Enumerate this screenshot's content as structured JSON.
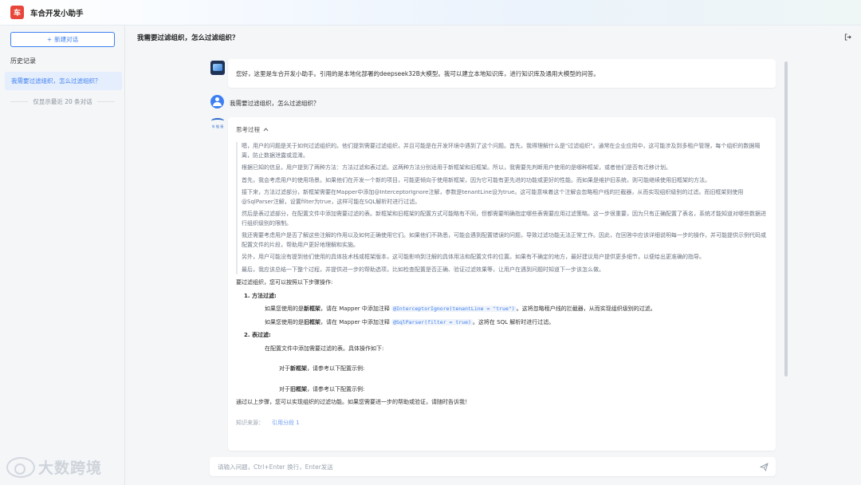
{
  "app": {
    "logo_char": "车",
    "title": "车合开发小助手"
  },
  "sidebar": {
    "new_chat_label": "新建对话",
    "history_title": "历史记录",
    "history_items": [
      "我需要过滤组织，怎么过滤组织？"
    ],
    "history_note": "仅显示最近 20 条对话"
  },
  "chat": {
    "title": "我需要过滤组织，怎么过滤组织？",
    "welcome": "您好，这里是车合开发小助手。引用的是本地化部署的deepseek32B大模型。我可以建立本地知识库，进行知识库及通用大模型的问答。",
    "user_message": "我需要过滤组织，怎么过滤组织？",
    "bot_logo_text": "车 链 接",
    "thinking_label": "思考过程",
    "thinking_paragraphs": [
      "嗯，用户的问题是关于如何过滤组织的。他们提到需要过滤组织，并且可能是在开发环境中遇到了这个问题。首先，我得理解什么是\"过滤组织\"。通常在企业应用中，这可能涉及到多租户管理，每个组织的数据隔离，防止数据泄露或混淆。",
      "根据已知的信息，用户提到了两种方法：方法过滤和表过滤。这两种方法分别适用于新框架和旧框架。所以，我需要先判断用户使用的是哪种框架，或者他们是否有迁移计划。",
      "首先，我会考虑用户的使用场景。如果他们在开发一个新的项目，可能更倾向于使用新框架，因为它可能有更先进的功能或更好的性能。而如果是维护旧系统，则可能继续使用旧框架的方法。",
      "接下来，方法过滤部分，新框架需要在Mapper中添加@InterceptorIgnore注解，参数是tenantLine设为true。这可能意味着这个注解会忽略租户线的拦截器，从而实现组织级别的过滤。而旧框架则使用@SqlParser注解，设置filter为true，这样可能在SQL解析时进行过滤。",
      "然后是表过滤部分，在配置文件中添加需要过滤的表。新框架和旧框架的配置方式可能略有不同，但都需要明确指定哪些表需要应用过滤策略。这一步很重要，因为只有正确配置了表名，系统才能知道对哪些数据进行组织级别的限制。",
      "我还需要考虑用户是否了解这些注解的作用以及如何正确使用它们。如果他们不熟悉，可能会遇到配置错误的问题，导致过滤功能无法正常工作。因此，在回答中应该详细说明每一步的操作，并可能提供示例代码或配置文件的片段，帮助用户更好地理解和实施。",
      "另外，用户可能没有提到他们使用的具体技术栈或框架版本，这可能影响到注解的具体用法和配置文件的位置。如果有不确定的地方，最好建议用户提供更多细节，以便给出更准确的指导。",
      "最后，我应该总结一下整个过程，并提供进一步的帮助选项，比如检查配置是否正确、验证过滤效果等，让用户在遇到问题时知道下一步该怎么做。"
    ],
    "answer_intro": "要过滤组织，您可以按照以下步骤操作:",
    "step1_title": "1. 方法过滤:",
    "step1_line1": {
      "pre": "如果您使用的是",
      "bold": "新框架",
      "mid": "，请在 Mapper 中添加注释 ",
      "code": "@InterceptorIgnore(tenantLine = \"true\")",
      "post": "。这将忽略租户线的拦截器，从而实现组织级别的过滤。"
    },
    "step1_line2": {
      "pre": "如果您使用的是",
      "bold": "旧框架",
      "mid": "，请在 Mapper 中添加注释 ",
      "code": "@SqlParser(filter = true)",
      "post": "。这将在 SQL 解析时进行过滤。"
    },
    "step2_title": "2. 表过滤:",
    "step2_line": "在配置文件中添加需要过滤的表。具体操作如下:",
    "step2_new": {
      "pre": "对于",
      "bold": "新框架",
      "post": "，请参考以下配置示例:"
    },
    "step2_old": {
      "pre": "对于",
      "bold": "旧框架",
      "post": "，请参考以下配置示例:"
    },
    "answer_outro": "通过以上步骤，您可以实现组织的过滤功能。如果您需要进一步的帮助或验证，请随时告诉我！",
    "sources_label": "知识来源：",
    "sources_ref": "引用分段 1"
  },
  "input": {
    "placeholder": "请输入问题，Ctrl+Enter 换行，Enter发送"
  },
  "watermark": {
    "text": "大数跨境"
  },
  "colors": {
    "accent": "#3d7ff2",
    "logo": "#e8463a"
  },
  "icons": {
    "new_chat": "plus-icon",
    "export": "export-icon",
    "collapse": "chevron-up-icon",
    "send": "send-icon"
  }
}
